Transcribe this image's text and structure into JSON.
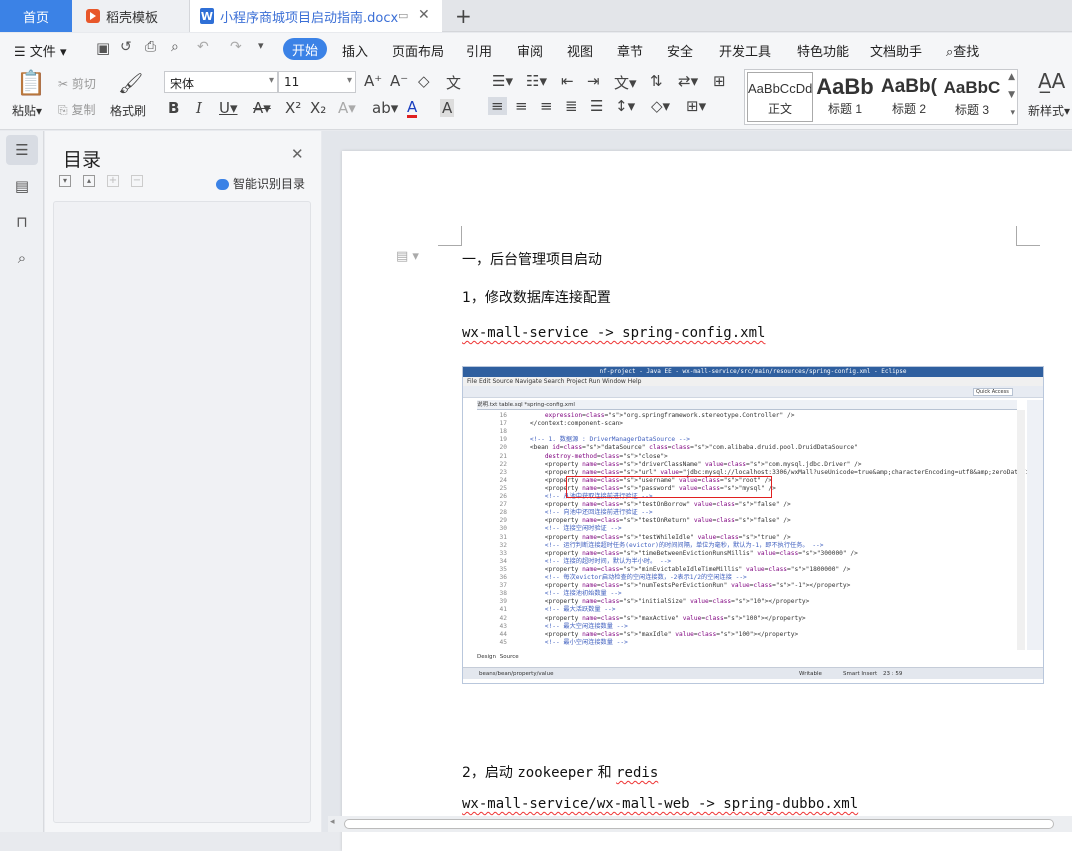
{
  "tabs": {
    "home": "首页",
    "template": "稻壳模板",
    "doc": "小程序商城项目启动指南.docx"
  },
  "menu": {
    "file": "文件",
    "start": "开始",
    "items": [
      "插入",
      "页面布局",
      "引用",
      "审阅",
      "视图",
      "章节",
      "安全",
      "开发工具",
      "特色功能",
      "文档助手"
    ],
    "search": "查找"
  },
  "ribbon": {
    "paste": "粘贴",
    "cut": "剪切",
    "copy": "复制",
    "format_painter": "格式刷",
    "font_name": "宋体",
    "font_size": "11",
    "styles": [
      {
        "preview": "AaBbCcDd",
        "label": "正文"
      },
      {
        "preview": "AaBb",
        "label": "标题 1"
      },
      {
        "preview": "AaBb(",
        "label": "标题 2"
      },
      {
        "preview": "AaBbC",
        "label": "标题 3"
      }
    ],
    "new_style": "新样式"
  },
  "toc": {
    "title": "目录",
    "smart": "智能识别目录"
  },
  "document": {
    "line1": "一，后台管理项目启动",
    "line2": "1，修改数据库连接配置",
    "line3": "wx-mall-service -> spring-config.xml",
    "line4": "2，启动 zookeeper 和 redis",
    "line5": "wx-mall-service/wx-mall-web -> spring-dubbo.xml"
  },
  "eclipse": {
    "title": "nf-project - Java EE - wx-mall-service/src/main/resources/spring-config.xml - Eclipse",
    "menu": "File  Edit  Source  Navigate  Search  Project  Run  Window  Help",
    "tabs": "说明.txt     table.sql     *spring-config.xml",
    "quick_access": "Quick Access",
    "status_path": "beans/bean/property/value",
    "status_writable": "Writable",
    "status_insert": "Smart Insert",
    "status_pos": "23 : 59",
    "design": "Design",
    "source": "Source"
  },
  "code_lines": [
    {
      "n": "16",
      "t": "        expression=\"org.springframework.stereotype.Controller\" />"
    },
    {
      "n": "17",
      "t": "    </context:component-scan>"
    },
    {
      "n": "18",
      "t": ""
    },
    {
      "n": "19",
      "t": "    <!-- 1. 数据源 : DriverManagerDataSource -->"
    },
    {
      "n": "20",
      "t": "    <bean id=\"dataSource\" class=\"com.alibaba.druid.pool.DruidDataSource\""
    },
    {
      "n": "21",
      "t": "        destroy-method=\"close\">"
    },
    {
      "n": "22",
      "t": "        <property name=\"driverClassName\" value=\"com.mysql.jdbc.Driver\" />"
    },
    {
      "n": "23",
      "t": "        <property name=\"url\" value=\"jdbc:mysql://localhost:3306/wxMall?useUnicode=true&amp;characterEncoding=utf8&amp;zeroDateTimeBehav"
    },
    {
      "n": "24",
      "t": "        <property name=\"username\" value=\"root\" />"
    },
    {
      "n": "25",
      "t": "        <property name=\"password\" value=\"mysql\" />"
    },
    {
      "n": "26",
      "t": "        <!-- 从池中获取连接前进行验证 -->"
    },
    {
      "n": "27",
      "t": "        <property name=\"testOnBorrow\" value=\"false\" />"
    },
    {
      "n": "28",
      "t": "        <!-- 向池中还回连接前进行验证 -->"
    },
    {
      "n": "29",
      "t": "        <property name=\"testOnReturn\" value=\"false\" />"
    },
    {
      "n": "30",
      "t": "        <!-- 连接空闲时验证 -->"
    },
    {
      "n": "31",
      "t": "        <property name=\"testWhileIdle\" value=\"true\" />"
    },
    {
      "n": "32",
      "t": "        <!-- 运行判断连接超时任务(evictor)的时间间隔，单位为毫秒，默认为-1，即不执行任务。 -->"
    },
    {
      "n": "33",
      "t": "        <property name=\"timeBetweenEvictionRunsMillis\" value=\"300000\" />"
    },
    {
      "n": "34",
      "t": "        <!-- 连接的超时时间，默认为半小时。 -->"
    },
    {
      "n": "35",
      "t": "        <property name=\"minEvictableIdleTimeMillis\" value=\"1800000\" />"
    },
    {
      "n": "36",
      "t": "        <!-- 每次evictor启动检查的空闲连接数，-2表示1/2的空闲连接 -->"
    },
    {
      "n": "37",
      "t": "        <property name=\"numTestsPerEvictionRun\" value=\"-1\"></property>"
    },
    {
      "n": "38",
      "t": "        <!-- 连接池初始数量 -->"
    },
    {
      "n": "39",
      "t": "        <property name=\"initialSize\" value=\"10\"></property>"
    },
    {
      "n": "41",
      "t": "        <!-- 最大活跃数量 -->"
    },
    {
      "n": "42",
      "t": "        <property name=\"maxActive\" value=\"100\"></property>"
    },
    {
      "n": "43",
      "t": "        <!-- 最大空闲连接数量 -->"
    },
    {
      "n": "44",
      "t": "        <property name=\"maxIdle\" value=\"100\"></property>"
    },
    {
      "n": "45",
      "t": "        <!-- 最小空闲连接数量 -->"
    }
  ]
}
